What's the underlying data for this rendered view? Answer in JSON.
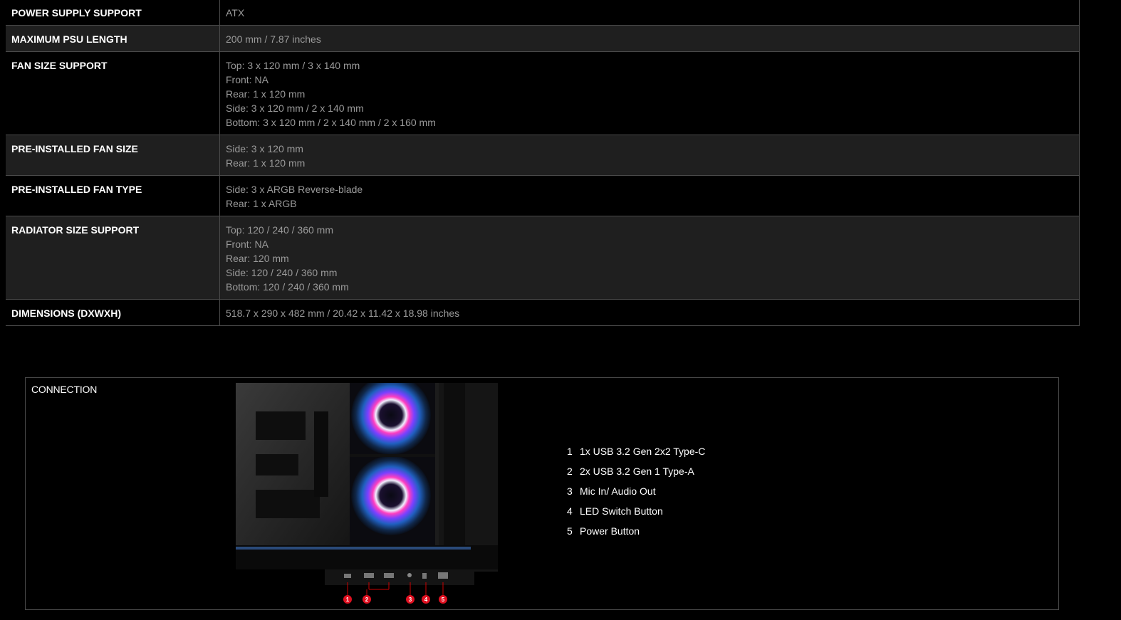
{
  "specs": [
    {
      "label": "POWER SUPPLY SUPPORT",
      "lines": [
        "ATX"
      ]
    },
    {
      "label": "MAXIMUM PSU LENGTH",
      "lines": [
        "200 mm / 7.87 inches"
      ]
    },
    {
      "label": "FAN SIZE SUPPORT",
      "lines": [
        "Top: 3 x 120 mm / 3 x 140 mm",
        "Front: NA",
        "Rear: 1 x 120 mm",
        "Side: 3 x 120 mm / 2 x 140 mm",
        "Bottom: 3 x 120 mm / 2 x 140 mm / 2 x 160 mm"
      ]
    },
    {
      "label": "PRE-INSTALLED FAN SIZE",
      "lines": [
        "Side: 3 x 120 mm",
        "Rear: 1 x 120 mm"
      ]
    },
    {
      "label": "PRE-INSTALLED FAN TYPE",
      "lines": [
        "Side: 3 x ARGB Reverse-blade",
        "Rear: 1 x ARGB"
      ]
    },
    {
      "label": "RADIATOR SIZE SUPPORT",
      "lines": [
        "Top: 120 / 240 / 360 mm",
        "Front: NA",
        "Rear: 120 mm",
        "Side: 120 / 240 / 360 mm",
        "Bottom: 120 / 240 / 360 mm"
      ]
    },
    {
      "label": "DIMENSIONS (DXWXH)",
      "lines": [
        "518.7 x 290 x 482 mm / 20.42 x 11.42 x 18.98 inches"
      ]
    }
  ],
  "connection": {
    "title": "CONNECTION",
    "items": [
      {
        "num": "1",
        "text": "1x USB 3.2 Gen 2x2 Type-C"
      },
      {
        "num": "2",
        "text": "2x USB 3.2 Gen 1 Type-A"
      },
      {
        "num": "3",
        "text": "Mic In/ Audio Out"
      },
      {
        "num": "4",
        "text": "LED Switch Button"
      },
      {
        "num": "5",
        "text": "Power Button"
      }
    ],
    "image_markers": [
      "1",
      "2",
      "3",
      "4",
      "5"
    ],
    "accent_color": "#e01020"
  }
}
